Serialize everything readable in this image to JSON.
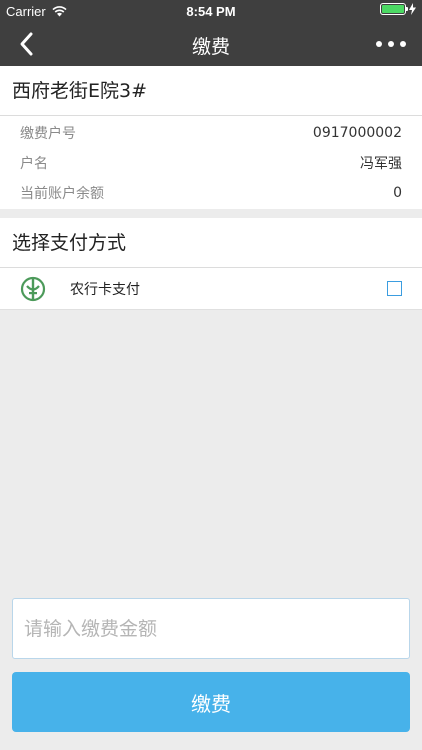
{
  "status_bar": {
    "carrier": "Carrier",
    "time": "8:54 PM"
  },
  "nav": {
    "title": "缴费"
  },
  "account": {
    "name": "西府老街E院3#",
    "rows": [
      {
        "label": "缴费户号",
        "value": "0917000002"
      },
      {
        "label": "户名",
        "value": "冯军强"
      },
      {
        "label": "当前账户余额",
        "value": "0"
      }
    ]
  },
  "payment": {
    "title": "选择支付方式",
    "method_label": "农行卡支付",
    "selected": false
  },
  "form": {
    "amount_placeholder": "请输入缴费金额",
    "submit_label": "缴费"
  },
  "colors": {
    "nav_background": "#3f3f3f",
    "accent": "#47b2ea",
    "bank_icon": "#4c9a5a",
    "battery": "#4cd964"
  }
}
